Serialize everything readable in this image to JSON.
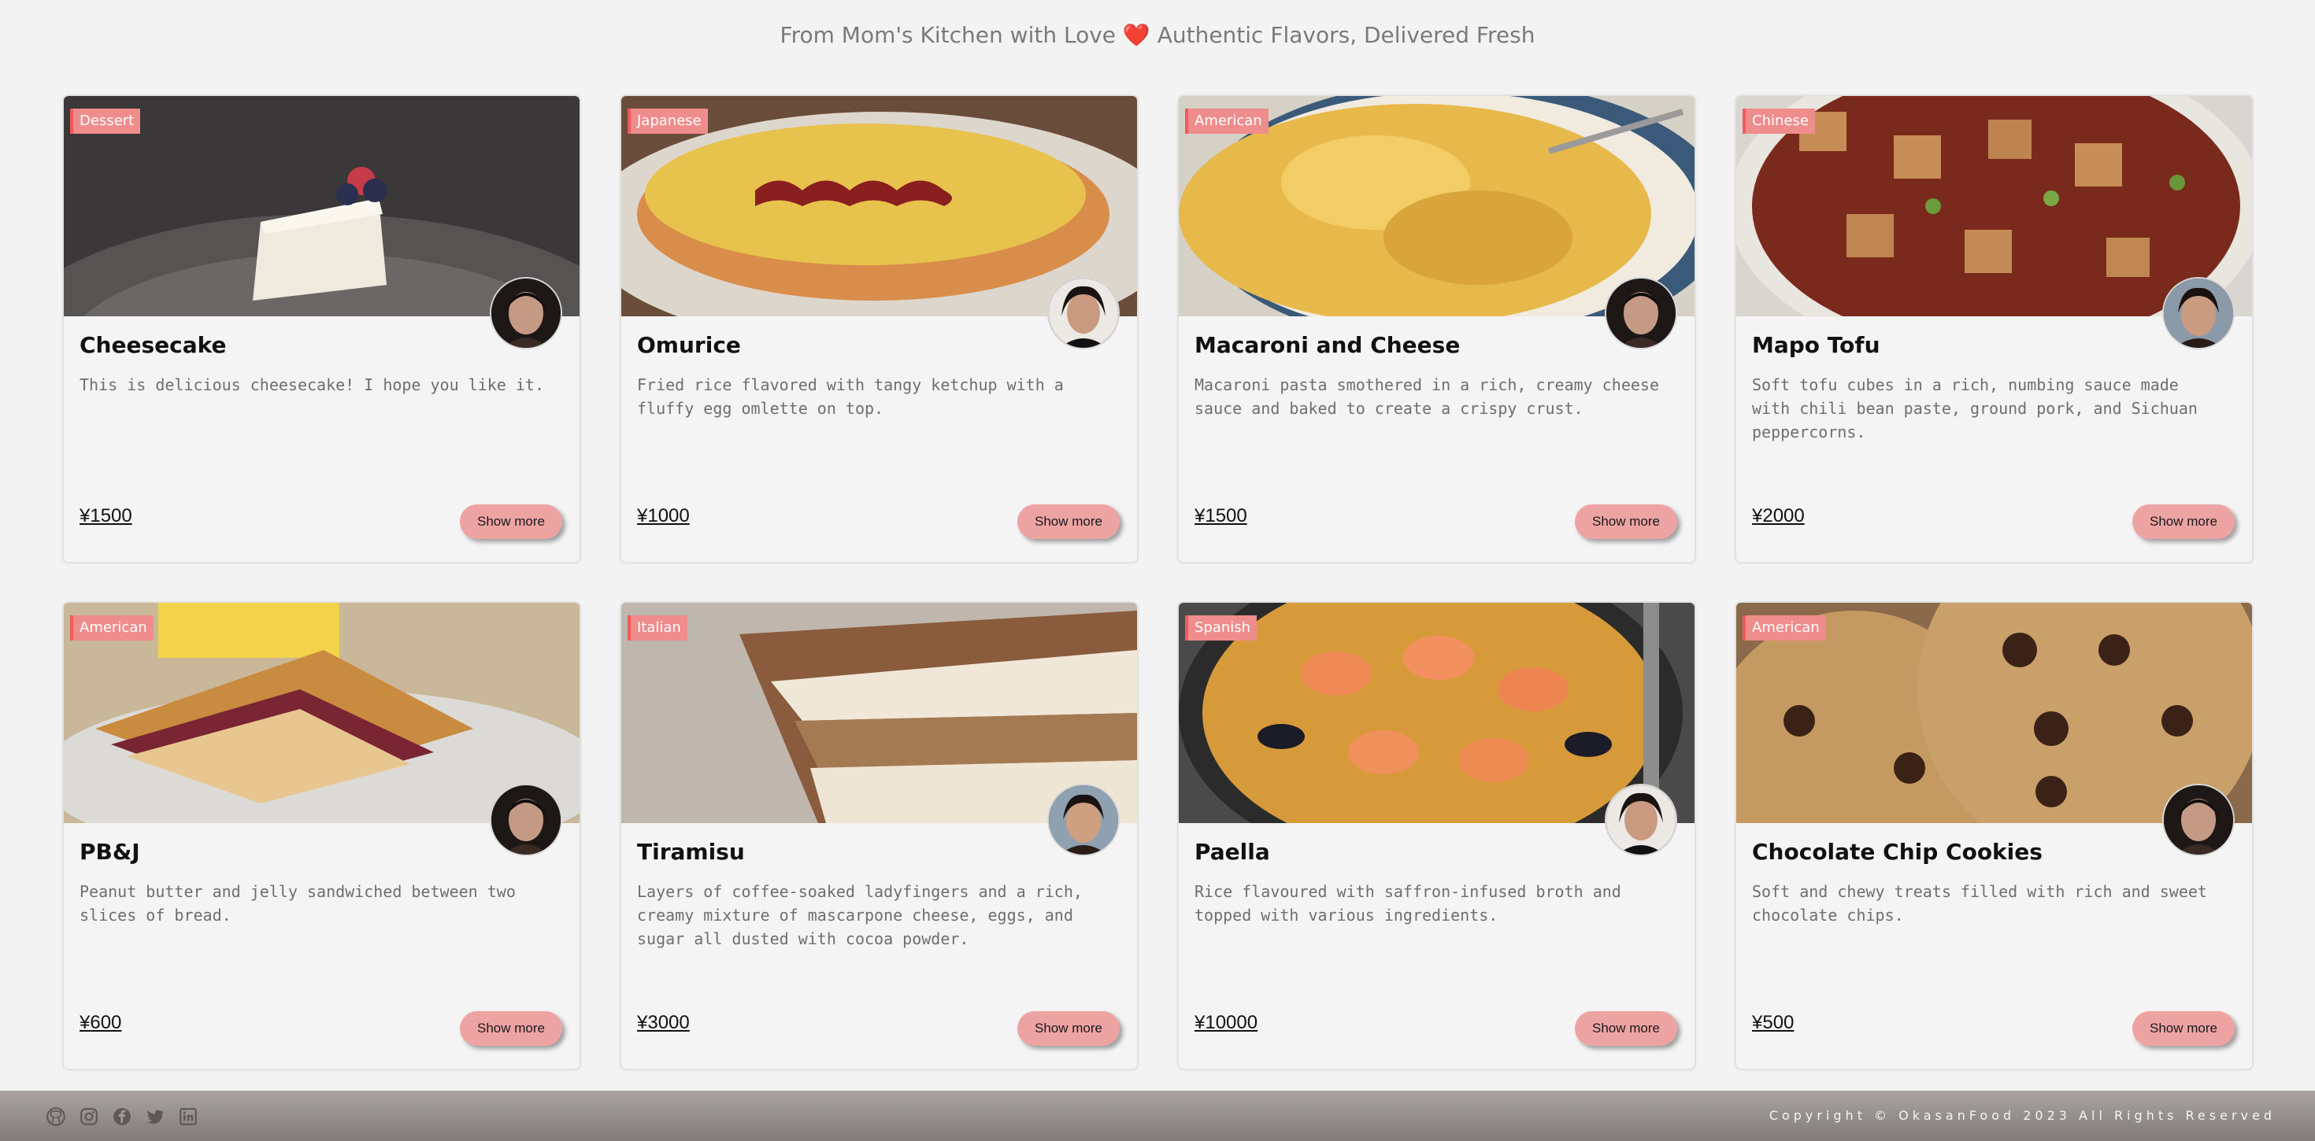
{
  "tagline": {
    "before": "From Mom's Kitchen with Love ",
    "heart": "❤️",
    "after": " Authentic Flavors, Delivered Fresh"
  },
  "button_label": "Show more",
  "cards": [
    {
      "category": "Dessert",
      "title": "Cheesecake",
      "description": "This is delicious cheesecake! I hope you like it.",
      "price": "¥1500"
    },
    {
      "category": "Japanese",
      "title": "Omurice",
      "description": "Fried rice flavored with tangy ketchup with a fluffy egg omlette on top.",
      "price": "¥1000"
    },
    {
      "category": "American",
      "title": "Macaroni and Cheese",
      "description": "Macaroni pasta smothered in a rich, creamy cheese sauce and baked to create a crispy crust.",
      "price": "¥1500"
    },
    {
      "category": "Chinese",
      "title": "Mapo Tofu",
      "description": "Soft tofu cubes in a rich, numbing sauce made with chili bean paste, ground pork, and Sichuan peppercorns.",
      "price": "¥2000"
    },
    {
      "category": "American",
      "title": "PB&J",
      "description": "Peanut butter and jelly sandwiched between two slices of bread.",
      "price": "¥600"
    },
    {
      "category": "Italian",
      "title": "Tiramisu",
      "description": "Layers of coffee-soaked ladyfingers and a rich, creamy mixture of mascarpone cheese, eggs, and sugar all dusted with cocoa powder.",
      "price": "¥3000"
    },
    {
      "category": "Spanish",
      "title": "Paella",
      "description": "Rice flavoured with saffron-infused broth and topped with various ingredients.",
      "price": "¥10000"
    },
    {
      "category": "American",
      "title": "Chocolate Chip Cookies",
      "description": "Soft and chewy treats filled with rich and sweet chocolate chips.",
      "price": "¥500"
    }
  ],
  "footer": {
    "social_icons": [
      "github-icon",
      "instagram-icon",
      "facebook-icon",
      "twitter-icon",
      "linkedin-icon"
    ],
    "copyright": "Copyright © OkasanFood 2023 All Rights Reserved"
  },
  "colors": {
    "badge": "#ef8c8c",
    "button": "#eea3a3",
    "background": "#f3f3f3"
  }
}
